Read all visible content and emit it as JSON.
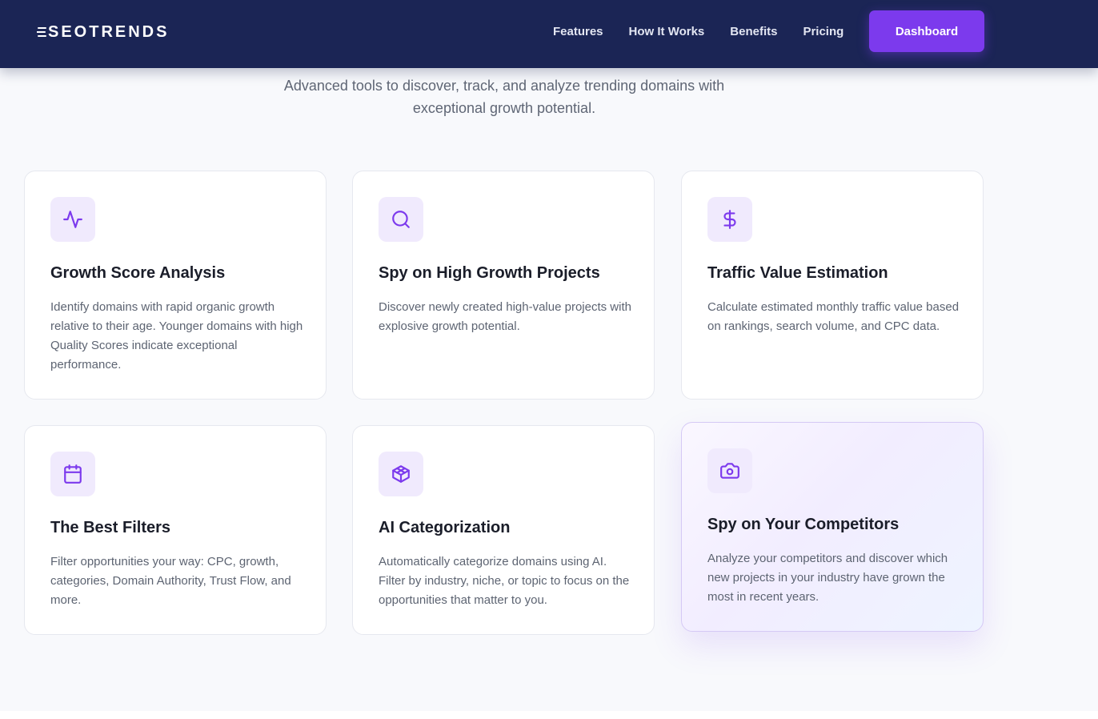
{
  "header": {
    "brand": "SEOTRENDS",
    "nav": [
      "Features",
      "How It Works",
      "Benefits",
      "Pricing"
    ],
    "cta": "Dashboard"
  },
  "hero": {
    "subtitle_line1": "Advanced tools to discover, track, and analyze trending domains with",
    "subtitle_line2": "exceptional growth potential."
  },
  "features": [
    {
      "icon": "activity-icon",
      "title": "Growth Score Analysis",
      "desc": "Identify domains with rapid organic growth relative to their age. Younger domains with high Quality Scores indicate exceptional performance."
    },
    {
      "icon": "search-icon",
      "title": "Spy on High Growth Projects",
      "desc": "Discover newly created high-value projects with explosive growth potential."
    },
    {
      "icon": "dollar-icon",
      "title": "Traffic Value Estimation",
      "desc": "Calculate estimated monthly traffic value based on rankings, search volume, and CPC data."
    },
    {
      "icon": "calendar-icon",
      "title": "The Best Filters",
      "desc": "Filter opportunities your way: CPC, growth, categories, Domain Authority, Trust Flow, and more."
    },
    {
      "icon": "cube-icon",
      "title": "AI Categorization",
      "desc": "Automatically categorize domains using AI. Filter by industry, niche, or topic to focus on the opportunities that matter to you."
    },
    {
      "icon": "camera-icon",
      "title": "Spy on Your Competitors",
      "desc": "Analyze your competitors and discover which new projects in your industry have grown the most in recent years."
    }
  ],
  "colors": {
    "navbar": "#1b2555",
    "accent": "#7c3aed",
    "icon_bg": "#f0eafd",
    "page_bg": "#f8f9fc"
  }
}
